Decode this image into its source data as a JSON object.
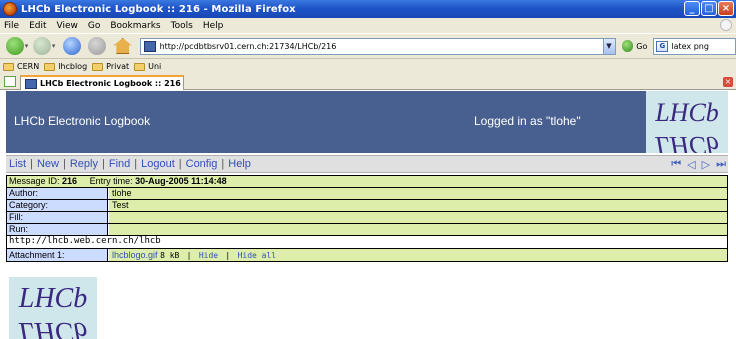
{
  "window": {
    "title": "LHCb Electronic Logbook :: 216 - Mozilla Firefox"
  },
  "menubar": [
    "File",
    "Edit",
    "View",
    "Go",
    "Bookmarks",
    "Tools",
    "Help"
  ],
  "navbar": {
    "url": "http://pcdbtbsrv01.cern.ch:21734/LHCb/216",
    "go_label": "Go",
    "search_value": "latex png"
  },
  "bookmarks": [
    "CERN",
    "lhcblog",
    "Privat",
    "Uni"
  ],
  "tab": {
    "label": "LHCb Electronic Logbook :: 216"
  },
  "page": {
    "header": {
      "title": "LHCb Electronic Logbook",
      "logged_in": "Logged in as \"tlohe\"",
      "logo_text": "LHCb"
    },
    "menu": [
      "List",
      "New",
      "Reply",
      "Find",
      "Logout",
      "Config",
      "Help"
    ],
    "message": {
      "id_label": "Message ID:",
      "id": "216",
      "entry_label": "Entry time:",
      "entry_time": "30-Aug-2005 11:14:48"
    },
    "fields": [
      {
        "label": "Author:",
        "value": "tlohe"
      },
      {
        "label": "Category:",
        "value": "Test"
      },
      {
        "label": "Fill:",
        "value": ""
      },
      {
        "label": "Run:",
        "value": ""
      }
    ],
    "body_text": "http://lhcb.web.cern.ch/lhcb",
    "attachment": {
      "label": "Attachment 1:",
      "filename": "lhcblogo.gif",
      "size": "8 kB",
      "hide": "Hide",
      "hide_all": "Hide all"
    }
  },
  "colors": {
    "header_bg": "#486090",
    "label_bg": "#ccdcff",
    "value_bg": "#ddeeaa",
    "link": "#3050b8"
  }
}
